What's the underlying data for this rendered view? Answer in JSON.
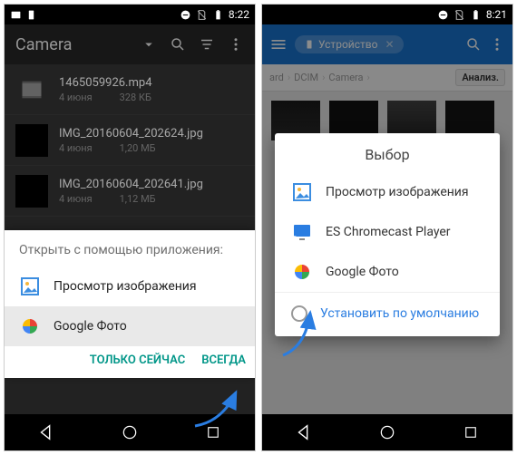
{
  "left": {
    "status": {
      "time": "8:22"
    },
    "toolbar": {
      "title": "Camera"
    },
    "files": [
      {
        "name": "1465059926.mp4",
        "date": "4 июня",
        "size": "328 КБ"
      },
      {
        "name": "IMG_20160604_202624.jpg",
        "date": "4 июня",
        "size": "1,20 МБ"
      },
      {
        "name": "IMG_20160604_202641.jpg",
        "date": "4 июня",
        "size": "1,12 МБ"
      }
    ],
    "chooser": {
      "title": "Открыть с помощью приложения:",
      "apps": [
        {
          "name": "Просмотр изображения"
        },
        {
          "name": "Google Фото"
        }
      ],
      "just_once": "ТОЛЬКО СЕЙЧАС",
      "always": "ВСЕГДА"
    }
  },
  "right": {
    "status": {
      "time": "8:21"
    },
    "toolbar": {
      "device_chip": "Устройство"
    },
    "breadcrumbs": {
      "a": "ard",
      "b": "DCIM",
      "c": "Camera",
      "analyze": "Анализ."
    },
    "dialog": {
      "title": "Выбор",
      "apps": [
        {
          "name": "Просмотр изображения"
        },
        {
          "name": "ES Chromecast Player"
        },
        {
          "name": "Google Фото"
        }
      ],
      "set_default": "Установить по умолчанию"
    }
  }
}
